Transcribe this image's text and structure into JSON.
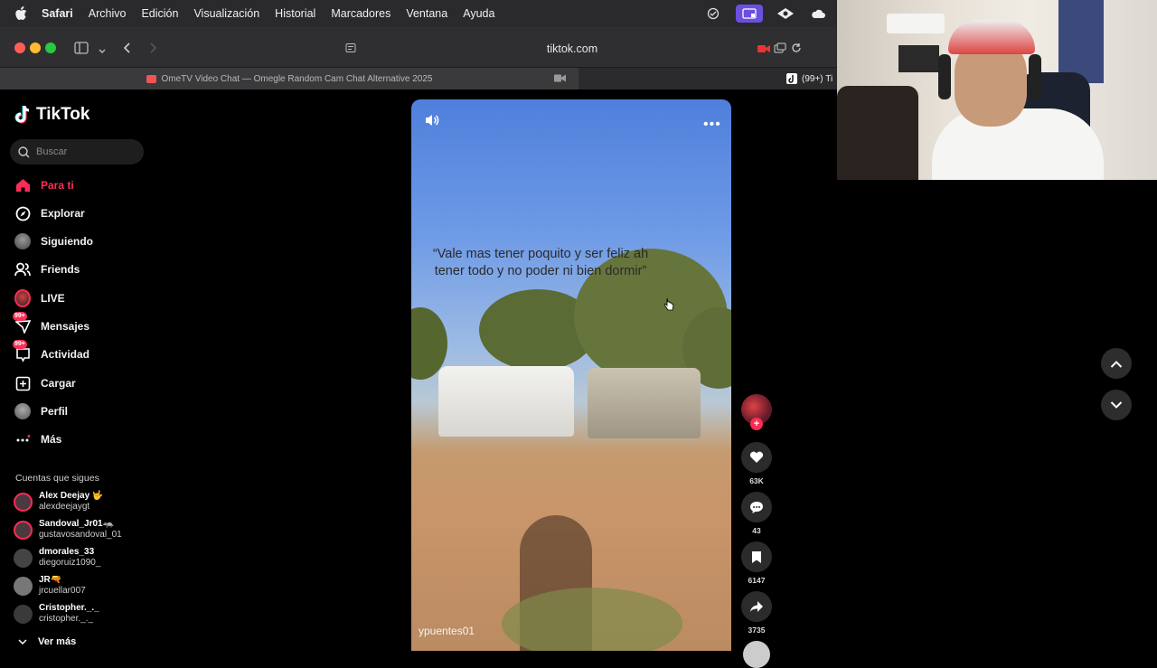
{
  "menubar": {
    "app": "Safari",
    "items": [
      "Archivo",
      "Edición",
      "Visualización",
      "Historial",
      "Marcadores",
      "Ventana",
      "Ayuda"
    ]
  },
  "browser": {
    "url": "tiktok.com",
    "tab1_title": "OmeTV Video Chat — Omegle Random Cam Chat Alternative 2025",
    "tab2_title": "(99+) Ti"
  },
  "sidebar": {
    "logo": "TikTok",
    "search_placeholder": "Buscar",
    "nav": [
      {
        "label": "Para ti",
        "icon": "home-icon",
        "active": true
      },
      {
        "label": "Explorar",
        "icon": "compass-icon"
      },
      {
        "label": "Siguiendo",
        "icon": "following-avatar-icon"
      },
      {
        "label": "Friends",
        "icon": "friends-icon"
      },
      {
        "label": "LIVE",
        "icon": "live-icon"
      },
      {
        "label": "Mensajes",
        "icon": "messages-icon",
        "badge": "99+"
      },
      {
        "label": "Actividad",
        "icon": "activity-icon",
        "badge": "99+"
      },
      {
        "label": "Cargar",
        "icon": "upload-icon"
      },
      {
        "label": "Perfil",
        "icon": "profile-avatar-icon"
      },
      {
        "label": "Más",
        "icon": "more-icon"
      }
    ],
    "following_heading": "Cuentas que sigues",
    "following": [
      {
        "name": "Alex Deejay 🤟",
        "handle": "alexdeejaygt",
        "live": true
      },
      {
        "name": "Sandoval_Jr01🦡",
        "handle": "gustavosandoval_01",
        "live": true
      },
      {
        "name": "dmorales_33",
        "handle": "diegoruiz1090_",
        "live": false
      },
      {
        "name": "JR🔫",
        "handle": "jrcuellar007",
        "live": false
      },
      {
        "name": "Cristopher._._",
        "handle": "cristopher._._",
        "live": false
      }
    ],
    "see_more": "Ver más"
  },
  "video": {
    "quote": "“Vale mas tener poquito y ser feliz ah tener todo y no poder ni bien dormir”",
    "username": "ypuentes01",
    "likes": "63K",
    "comments": "43",
    "saves": "6147",
    "shares": "3735"
  },
  "colors": {
    "accent": "#fe2c55",
    "menubar": "#2a2a2c",
    "toolbar": "#2f2f31"
  }
}
